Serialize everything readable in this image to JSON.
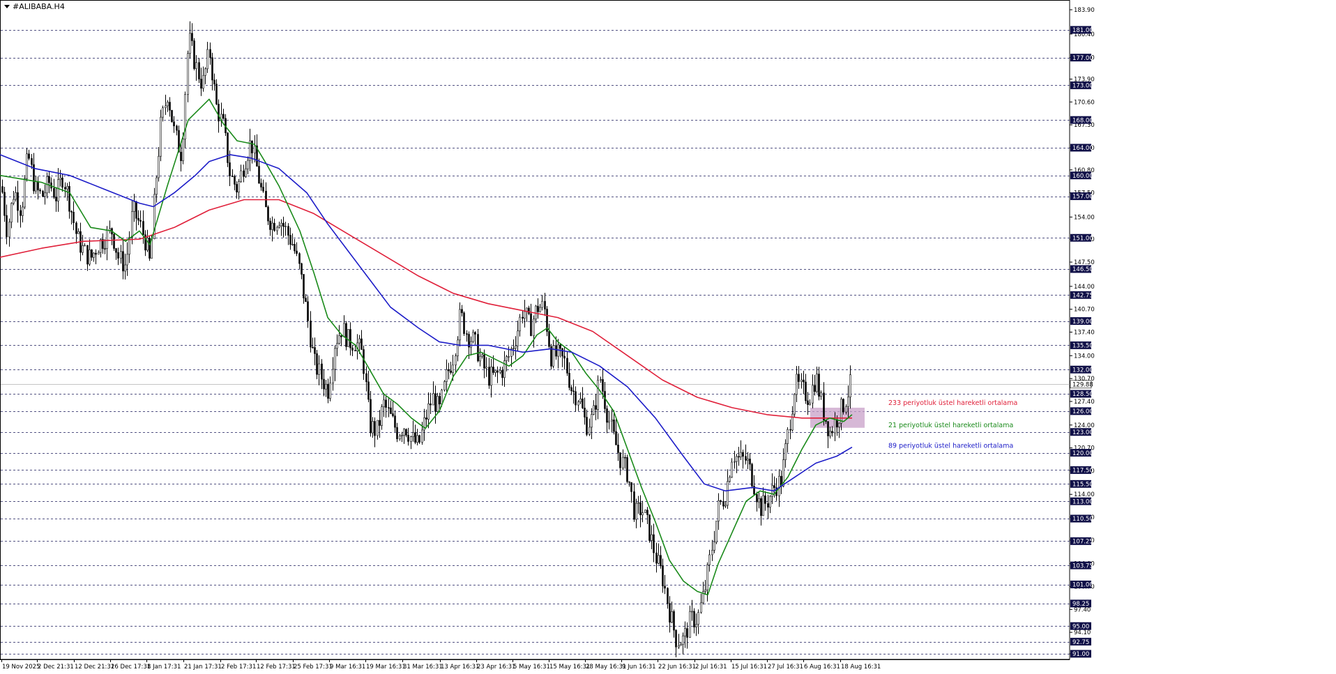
{
  "window": {
    "title": "#ALIBABA.H4"
  },
  "colors": {
    "background": "#ffffff",
    "grid": "#1a1a5a",
    "candle": "#000000",
    "ema233": "#e0203a",
    "ema21": "#1a8a1a",
    "ema89": "#1c1cc8",
    "zone": "#c8a0c8",
    "price_tag_bg": "#101048",
    "price_tag_text": "#ffffff"
  },
  "chart_data": {
    "type": "candlestick",
    "title": "#ALIBABA.H4",
    "ylim": [
      91,
      184
    ],
    "y_ticks": [
      183.9,
      180.4,
      177.0,
      173.9,
      170.6,
      167.3,
      164.0,
      160.8,
      157.5,
      154.0,
      150.8,
      147.5,
      144.0,
      140.7,
      137.4,
      134.0,
      130.7,
      127.4,
      124.0,
      120.7,
      117.4,
      114.0,
      110.7,
      107.4,
      104.0,
      100.7,
      97.4,
      94.1,
      91.0
    ],
    "highlighted_levels": [
      181.0,
      177.0,
      173.0,
      168.0,
      164.0,
      160.0,
      157.0,
      151.0,
      146.5,
      142.75,
      139.0,
      135.5,
      132.0,
      128.5,
      126.0,
      123.0,
      120.0,
      117.5,
      115.5,
      113.0,
      110.5,
      107.25,
      103.75,
      101.0,
      98.25,
      95.0,
      92.75,
      91.0
    ],
    "current_price": 129.88,
    "x_labels": [
      "19 Nov 2025",
      "2 Dec 21:31",
      "12 Dec 21:31",
      "26 Dec 17:31",
      "8 Jan 17:31",
      "21 Jan 17:31",
      "2 Feb 17:31",
      "12 Feb 17:31",
      "25 Feb 17:31",
      "9 Mar 16:31",
      "19 Mar 16:31",
      "31 Mar 16:31",
      "13 Apr 16:31",
      "23 Apr 16:31",
      "5 May 16:31",
      "15 May 16:31",
      "28 May 16:31",
      "9 Jun 16:31",
      "22 Jun 16:31",
      "2 Jul 16:31",
      "15 Jul 16:31",
      "27 Jul 16:31",
      "6 Aug 16:31",
      "18 Aug 16:31"
    ],
    "price_path": [
      [
        0,
        160
      ],
      [
        10,
        152
      ],
      [
        20,
        158
      ],
      [
        30,
        155
      ],
      [
        40,
        163
      ],
      [
        50,
        158
      ],
      [
        60,
        157
      ],
      [
        70,
        159
      ],
      [
        80,
        157
      ],
      [
        90,
        160
      ],
      [
        100,
        156
      ],
      [
        110,
        151
      ],
      [
        120,
        149
      ],
      [
        130,
        148
      ],
      [
        140,
        150
      ],
      [
        150,
        151
      ],
      [
        160,
        152
      ],
      [
        170,
        148
      ],
      [
        180,
        147
      ],
      [
        190,
        155
      ],
      [
        200,
        153
      ],
      [
        210,
        150
      ],
      [
        215,
        147
      ],
      [
        222,
        158
      ],
      [
        230,
        167
      ],
      [
        240,
        172
      ],
      [
        250,
        166
      ],
      [
        260,
        163
      ],
      [
        270,
        180
      ],
      [
        280,
        176
      ],
      [
        290,
        173
      ],
      [
        300,
        178
      ],
      [
        310,
        170
      ],
      [
        320,
        167
      ],
      [
        330,
        160
      ],
      [
        340,
        158
      ],
      [
        350,
        162
      ],
      [
        360,
        165
      ],
      [
        370,
        160
      ],
      [
        380,
        155
      ],
      [
        390,
        153
      ],
      [
        400,
        154
      ],
      [
        410,
        152
      ],
      [
        420,
        150
      ],
      [
        430,
        146
      ],
      [
        440,
        140
      ],
      [
        450,
        133
      ],
      [
        460,
        131
      ],
      [
        470,
        129
      ],
      [
        480,
        136
      ],
      [
        490,
        138
      ],
      [
        500,
        136
      ],
      [
        510,
        136
      ],
      [
        520,
        134
      ],
      [
        530,
        124
      ],
      [
        540,
        123
      ],
      [
        550,
        127
      ],
      [
        560,
        125
      ],
      [
        570,
        123
      ],
      [
        580,
        124
      ],
      [
        590,
        122
      ],
      [
        600,
        121
      ],
      [
        610,
        125
      ],
      [
        620,
        128
      ],
      [
        630,
        126
      ],
      [
        640,
        131
      ],
      [
        650,
        134
      ],
      [
        660,
        140
      ],
      [
        670,
        137
      ],
      [
        680,
        136
      ],
      [
        690,
        133
      ],
      [
        700,
        131
      ],
      [
        710,
        131
      ],
      [
        720,
        132
      ],
      [
        730,
        134
      ],
      [
        740,
        137
      ],
      [
        750,
        141
      ],
      [
        760,
        138
      ],
      [
        770,
        141
      ],
      [
        780,
        141
      ],
      [
        790,
        134
      ],
      [
        800,
        134
      ],
      [
        810,
        133
      ],
      [
        820,
        129
      ],
      [
        830,
        128
      ],
      [
        840,
        124
      ],
      [
        850,
        125
      ],
      [
        860,
        131
      ],
      [
        870,
        126
      ],
      [
        880,
        122
      ],
      [
        890,
        119
      ],
      [
        900,
        117
      ],
      [
        910,
        111
      ],
      [
        920,
        112
      ],
      [
        930,
        109
      ],
      [
        940,
        105
      ],
      [
        950,
        102
      ],
      [
        960,
        97
      ],
      [
        970,
        93
      ],
      [
        980,
        93
      ],
      [
        990,
        96
      ],
      [
        1000,
        96
      ],
      [
        1010,
        100
      ],
      [
        1020,
        106
      ],
      [
        1030,
        112
      ],
      [
        1040,
        114
      ],
      [
        1050,
        120
      ],
      [
        1060,
        119
      ],
      [
        1070,
        119
      ],
      [
        1080,
        116
      ],
      [
        1090,
        112
      ],
      [
        1100,
        113
      ],
      [
        1110,
        115
      ],
      [
        1120,
        116
      ],
      [
        1130,
        123
      ],
      [
        1140,
        130
      ],
      [
        1150,
        129
      ],
      [
        1160,
        128
      ],
      [
        1170,
        131
      ],
      [
        1180,
        126
      ],
      [
        1190,
        123
      ],
      [
        1200,
        125
      ],
      [
        1210,
        127
      ],
      [
        1220,
        130
      ]
    ],
    "series": [
      {
        "name": "233 periyotluk üstel hareketli ortalama",
        "color": "#e0203a",
        "points": [
          [
            0,
            148.2
          ],
          [
            60,
            149.5
          ],
          [
            120,
            150.5
          ],
          [
            200,
            150.8
          ],
          [
            250,
            152.5
          ],
          [
            300,
            155.0
          ],
          [
            350,
            156.5
          ],
          [
            400,
            156.5
          ],
          [
            450,
            154.5
          ],
          [
            500,
            151.5
          ],
          [
            550,
            148.5
          ],
          [
            600,
            145.5
          ],
          [
            650,
            143.0
          ],
          [
            700,
            141.5
          ],
          [
            750,
            140.5
          ],
          [
            800,
            139.5
          ],
          [
            850,
            137.5
          ],
          [
            900,
            134.0
          ],
          [
            950,
            130.5
          ],
          [
            1000,
            128.0
          ],
          [
            1050,
            126.5
          ],
          [
            1100,
            125.5
          ],
          [
            1150,
            125.0
          ],
          [
            1222,
            125.0
          ]
        ]
      },
      {
        "name": "21 periyotluk üstel hareketli ortalama",
        "color": "#1a8a1a",
        "points": [
          [
            0,
            160
          ],
          [
            30,
            159.5
          ],
          [
            60,
            159
          ],
          [
            100,
            157.5
          ],
          [
            130,
            152.5
          ],
          [
            160,
            152
          ],
          [
            180,
            150.5
          ],
          [
            200,
            152
          ],
          [
            215,
            150
          ],
          [
            240,
            158.5
          ],
          [
            270,
            168
          ],
          [
            300,
            171
          ],
          [
            320,
            167.5
          ],
          [
            340,
            165
          ],
          [
            365,
            164.5
          ],
          [
            380,
            162
          ],
          [
            400,
            158.5
          ],
          [
            430,
            152
          ],
          [
            450,
            146
          ],
          [
            470,
            139.5
          ],
          [
            490,
            137
          ],
          [
            510,
            135.5
          ],
          [
            530,
            132
          ],
          [
            550,
            128.5
          ],
          [
            570,
            127
          ],
          [
            590,
            125
          ],
          [
            610,
            123.5
          ],
          [
            630,
            126
          ],
          [
            650,
            131
          ],
          [
            670,
            134
          ],
          [
            690,
            134.5
          ],
          [
            710,
            133.5
          ],
          [
            730,
            132.5
          ],
          [
            750,
            134
          ],
          [
            770,
            137
          ],
          [
            785,
            138
          ],
          [
            800,
            136
          ],
          [
            820,
            134.5
          ],
          [
            840,
            131.5
          ],
          [
            860,
            129
          ],
          [
            880,
            126
          ],
          [
            900,
            120.5
          ],
          [
            920,
            115
          ],
          [
            940,
            110
          ],
          [
            960,
            104.5
          ],
          [
            980,
            101.5
          ],
          [
            1000,
            100
          ],
          [
            1015,
            99.5
          ],
          [
            1030,
            104
          ],
          [
            1050,
            108.5
          ],
          [
            1070,
            113
          ],
          [
            1090,
            114.5
          ],
          [
            1110,
            114
          ],
          [
            1130,
            116.5
          ],
          [
            1150,
            120.5
          ],
          [
            1170,
            124
          ],
          [
            1190,
            125
          ],
          [
            1210,
            124.5
          ],
          [
            1222,
            125.5
          ]
        ]
      },
      {
        "name": "89 periyotluk üstel hareketli ortalama",
        "color": "#1c1cc8",
        "points": [
          [
            0,
            163
          ],
          [
            50,
            161
          ],
          [
            100,
            160
          ],
          [
            150,
            158
          ],
          [
            200,
            156
          ],
          [
            220,
            155.5
          ],
          [
            250,
            157.5
          ],
          [
            280,
            160
          ],
          [
            300,
            162
          ],
          [
            330,
            163
          ],
          [
            360,
            162.5
          ],
          [
            400,
            161
          ],
          [
            440,
            157.5
          ],
          [
            470,
            153
          ],
          [
            500,
            149
          ],
          [
            530,
            145
          ],
          [
            560,
            141
          ],
          [
            600,
            138
          ],
          [
            630,
            136
          ],
          [
            660,
            135.5
          ],
          [
            700,
            135.5
          ],
          [
            750,
            134.5
          ],
          [
            790,
            135
          ],
          [
            820,
            134.5
          ],
          [
            860,
            132.5
          ],
          [
            900,
            129.5
          ],
          [
            940,
            125
          ],
          [
            980,
            119.5
          ],
          [
            1010,
            115.5
          ],
          [
            1040,
            114.5
          ],
          [
            1080,
            115
          ],
          [
            1110,
            114.5
          ],
          [
            1140,
            116.5
          ],
          [
            1170,
            118.5
          ],
          [
            1200,
            119.5
          ],
          [
            1222,
            120.8
          ]
        ]
      }
    ],
    "annotations": [
      {
        "text": "233 periyotluk üstel hareketli ortalama",
        "color": "#e0203a",
        "price": 127.2
      },
      {
        "text": "21 periyotluk üstel hareketli ortalama",
        "color": "#1a8a1a",
        "price": 124.0
      },
      {
        "text": "89 periyotluk üstel hareketli ortalama",
        "color": "#1c1cc8",
        "price": 121.0
      }
    ],
    "zone": {
      "price_top": 126.5,
      "price_bottom": 123.6,
      "x_start": 1162,
      "x_end": 1240
    },
    "grid": true,
    "legend": "none"
  }
}
